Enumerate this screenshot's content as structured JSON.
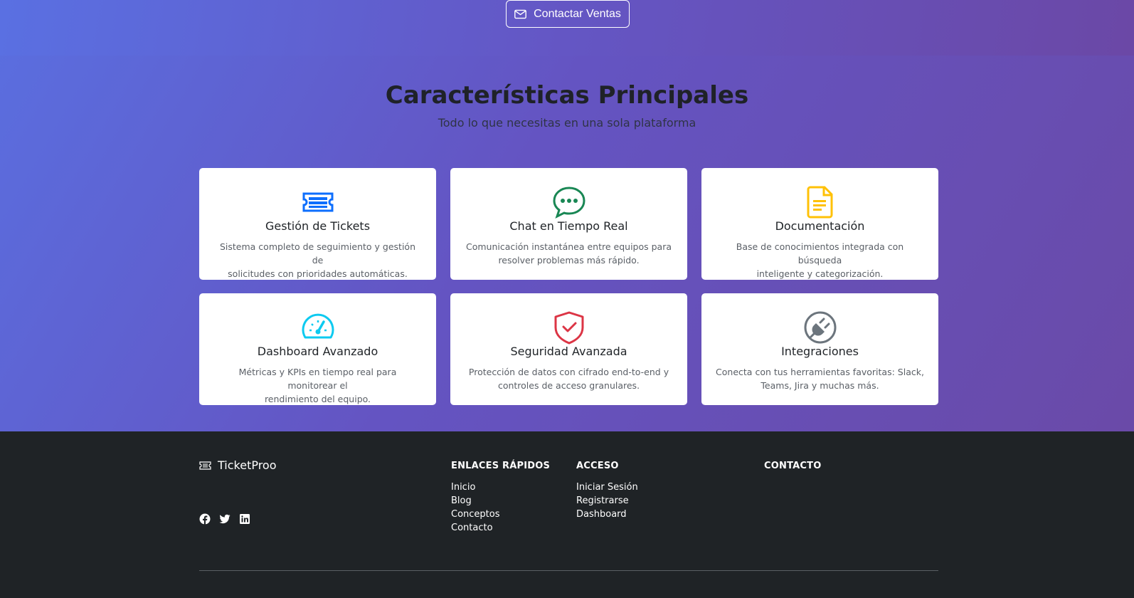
{
  "hero": {
    "cta_label": "Contactar Ventas"
  },
  "features": {
    "title": "Características Principales",
    "subtitle": "Todo lo que necesitas en una sola plataforma",
    "cards": [
      {
        "icon": "ticket-icon",
        "color": "#0d6efd",
        "title": "Gestión de Tickets",
        "desc_line1": "Sistema completo de seguimiento y gestión de",
        "desc_line2": "solicitudes con prioridades automáticas."
      },
      {
        "icon": "chat-icon",
        "color": "#198754",
        "title": "Chat en Tiempo Real",
        "desc_line1": "Comunicación instantánea entre equipos para",
        "desc_line2": "resolver problemas más rápido."
      },
      {
        "icon": "document-icon",
        "color": "#ffc107",
        "title": "Documentación",
        "desc_line1": "Base de conocimientos integrada con búsqueda",
        "desc_line2": "inteligente y categorización."
      },
      {
        "icon": "speedometer-icon",
        "color": "#0dcaf0",
        "title": "Dashboard Avanzado",
        "desc_line1": "Métricas y KPIs en tiempo real para monitorear el",
        "desc_line2": "rendimiento del equipo."
      },
      {
        "icon": "shield-check-icon",
        "color": "#dc3545",
        "title": "Seguridad Avanzada",
        "desc_line1": "Protección de datos con cifrado end-to-end y",
        "desc_line2": "controles de acceso granulares."
      },
      {
        "icon": "plug-icon",
        "color": "#6c757d",
        "title": "Integraciones",
        "desc_line1": "Conecta con tus herramientas favoritas: Slack,",
        "desc_line2": "Teams, Jira y muchas más."
      }
    ]
  },
  "footer": {
    "brand": "TicketProo",
    "quick_links_title": "ENLACES RÁPIDOS",
    "quick_links": [
      "Inicio",
      "Blog",
      "Conceptos",
      "Contacto"
    ],
    "access_title": "ACCESO",
    "access_links": [
      "Iniciar Sesión",
      "Registrarse",
      "Dashboard"
    ],
    "contact_title": "CONTACTO",
    "social": [
      "facebook-icon",
      "twitter-icon",
      "linkedin-icon"
    ]
  }
}
